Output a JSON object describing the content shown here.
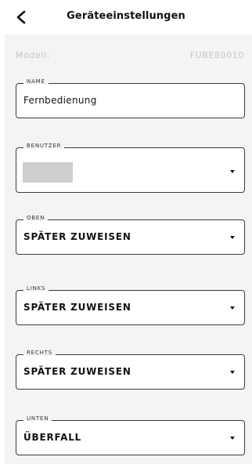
{
  "header": {
    "title": "Geräteeinstellungen",
    "back_icon": "chevron-left-icon"
  },
  "model": {
    "label": "Modell:",
    "value": "FUBE80010"
  },
  "fields": {
    "name": {
      "legend": "NAME",
      "value": "Fernbedienung"
    },
    "benutzer": {
      "legend": "BENUTZER",
      "value": ""
    },
    "oben": {
      "legend": "OBEN",
      "value": "SPÄTER ZUWEISEN"
    },
    "links": {
      "legend": "LINKS",
      "value": "SPÄTER ZUWEISEN"
    },
    "rechts": {
      "legend": "RECHTS",
      "value": "SPÄTER ZUWEISEN"
    },
    "unten": {
      "legend": "UNTEN",
      "value": "ÜBERFALL"
    }
  },
  "colors": {
    "panel_bg": "#f4f4f4",
    "border": "#3a3a3a",
    "muted_text": "#c4c4c4"
  }
}
